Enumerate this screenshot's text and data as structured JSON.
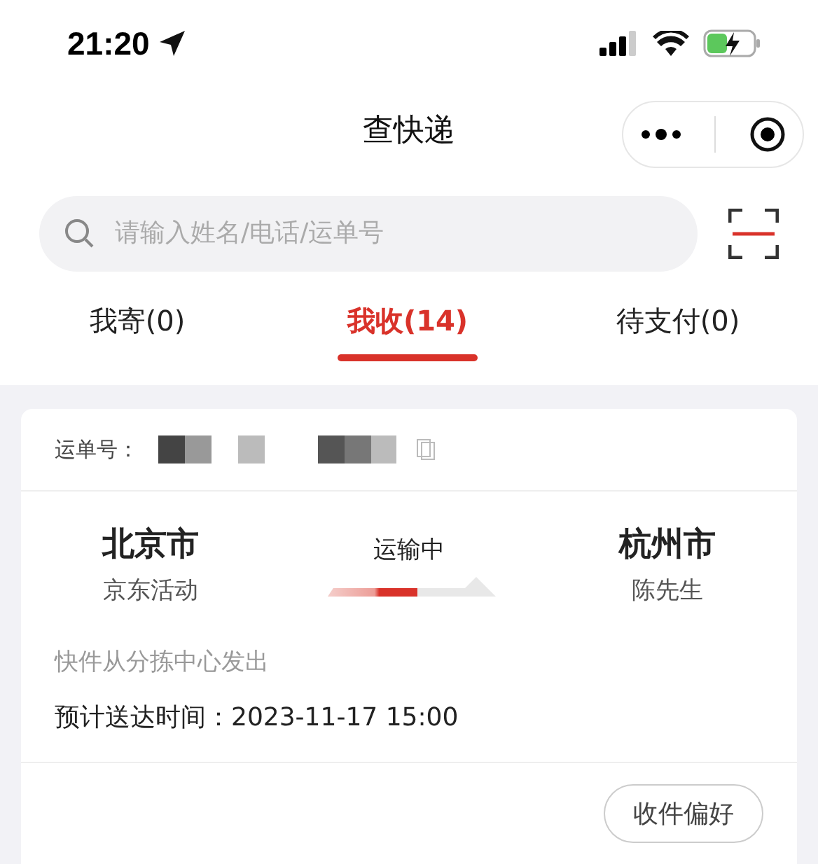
{
  "status_bar": {
    "time": "21:20"
  },
  "nav": {
    "title": "查快递"
  },
  "search": {
    "placeholder": "请输入姓名/电话/运单号"
  },
  "tabs": [
    {
      "label": "我寄(0)",
      "selected": false
    },
    {
      "label": "我收(14)",
      "selected": true
    },
    {
      "label": "待支付(0)",
      "selected": false
    }
  ],
  "shipment": {
    "waybill_label": "运单号：",
    "from_city": "北京市",
    "from_name": "京东活动",
    "status": "运输中",
    "progress": {
      "level": 0.55
    },
    "to_city": "杭州市",
    "to_name": "陈先生",
    "latest": "快件从分拣中心发出",
    "eta": "预计送达时间：2023-11-17 15:00",
    "action": "收件偏好"
  }
}
